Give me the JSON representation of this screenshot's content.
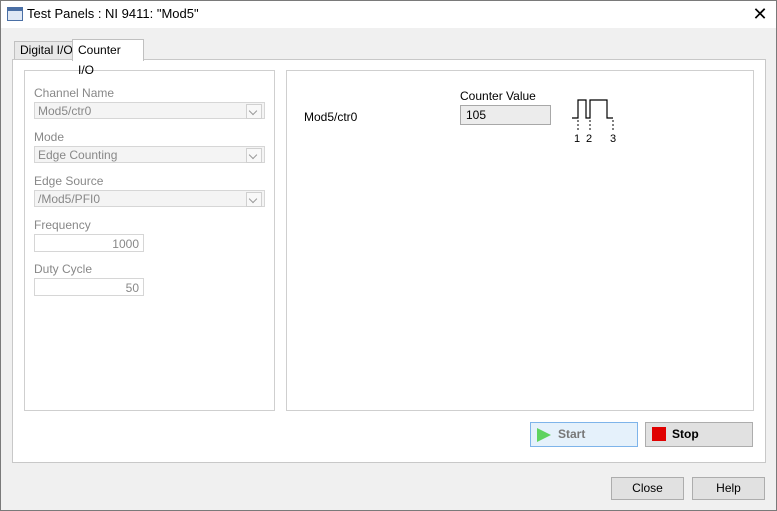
{
  "window": {
    "title": "Test Panels : NI 9411: \"Mod5\""
  },
  "tabs": [
    {
      "label": "Digital I/O"
    },
    {
      "label": "Counter I/O"
    }
  ],
  "config": {
    "channel_name": {
      "label": "Channel Name",
      "value": "Mod5/ctr0"
    },
    "mode": {
      "label": "Mode",
      "value": "Edge Counting"
    },
    "edge_source": {
      "label": "Edge Source",
      "value": "/Mod5/PFI0"
    },
    "frequency": {
      "label": "Frequency",
      "value": "1000"
    },
    "duty_cycle": {
      "label": "Duty Cycle",
      "value": "50"
    }
  },
  "display": {
    "channel": "Mod5/ctr0",
    "counter_label": "Counter Value",
    "counter_value": "105",
    "pulse_markers": [
      "1",
      "2",
      "3"
    ]
  },
  "buttons": {
    "start": "Start",
    "stop": "Stop",
    "close": "Close",
    "help": "Help"
  },
  "colors": {
    "stop_square": "#e00000",
    "start_triangle": "#5fd35f"
  }
}
